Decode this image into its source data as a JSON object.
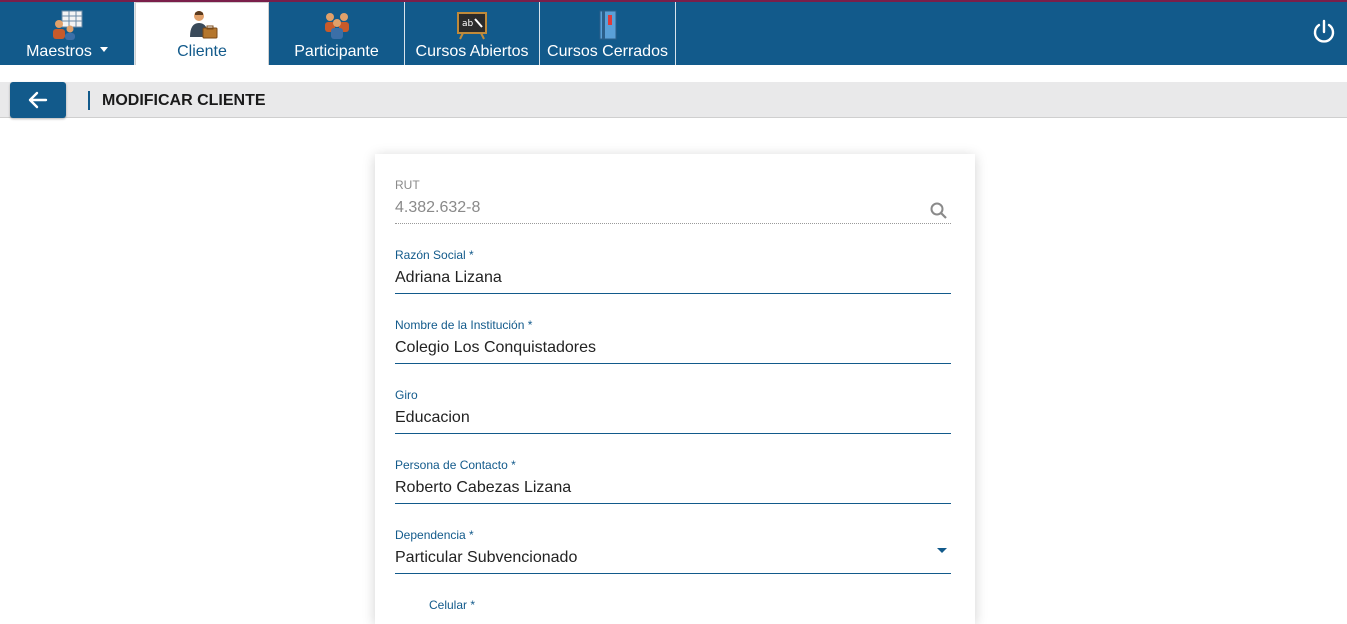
{
  "nav": {
    "items": [
      {
        "label": "Maestros",
        "icon": "teachers-icon"
      },
      {
        "label": "Cliente",
        "icon": "client-icon"
      },
      {
        "label": "Participante",
        "icon": "participants-icon"
      },
      {
        "label": "Cursos Abiertos",
        "icon": "blackboard-icon"
      },
      {
        "label": "Cursos Cerrados",
        "icon": "books-icon"
      }
    ],
    "active": "Cliente"
  },
  "header": {
    "title": "MODIFICAR CLIENTE"
  },
  "form": {
    "rut": {
      "label": "RUT",
      "value": "4.382.632-8"
    },
    "razon_social": {
      "label": "Razón Social *",
      "value": "Adriana Lizana"
    },
    "institucion": {
      "label": "Nombre de la Institución *",
      "value": "Colegio Los Conquistadores"
    },
    "giro": {
      "label": "Giro",
      "value": "Educacion"
    },
    "contacto": {
      "label": "Persona de Contacto *",
      "value": "Roberto Cabezas Lizana"
    },
    "dependencia": {
      "label": "Dependencia *",
      "value": "Particular Subvencionado"
    },
    "celular": {
      "label": "Celular *"
    }
  },
  "colors": {
    "primary": "#125a8b",
    "subbar": "#e9e9ea"
  }
}
